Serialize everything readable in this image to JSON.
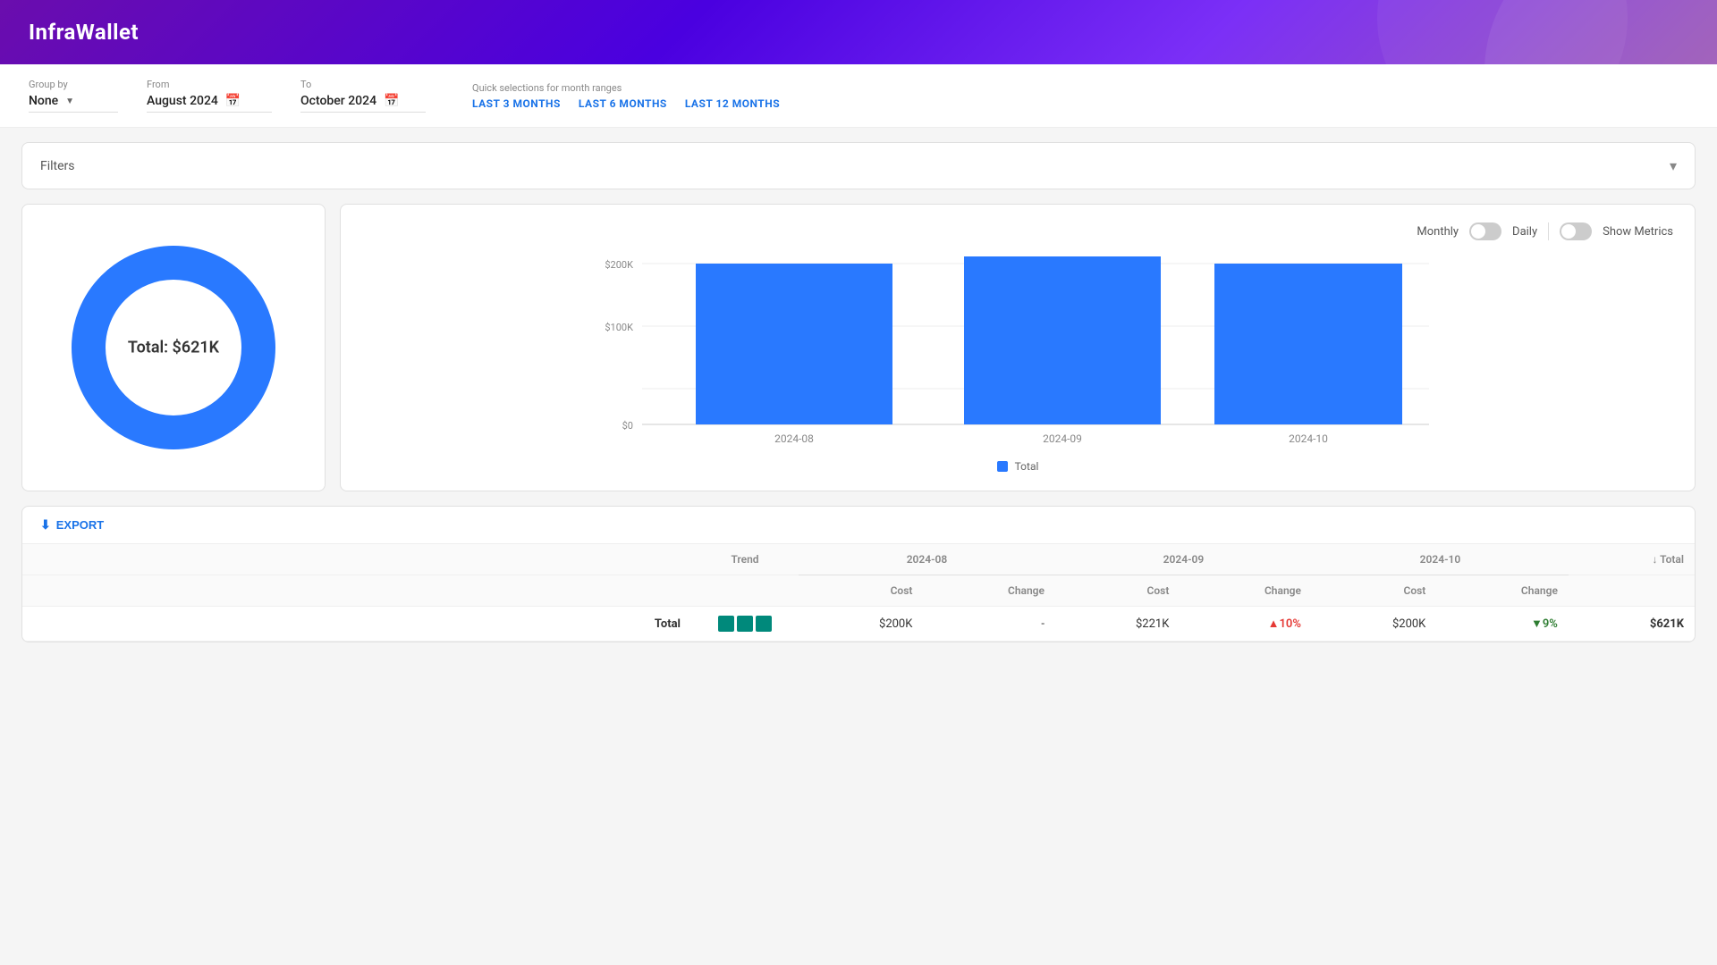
{
  "header": {
    "logo": "InfraWallet"
  },
  "controls": {
    "group_by_label": "Group by",
    "group_by_value": "None",
    "from_label": "From",
    "from_value": "August 2024",
    "to_label": "To",
    "to_value": "October 2024",
    "quick_label": "Quick selections for month ranges",
    "quick_links": [
      {
        "id": "last3",
        "label": "LAST 3 MONTHS"
      },
      {
        "id": "last6",
        "label": "LAST 6 MONTHS"
      },
      {
        "id": "last12",
        "label": "LAST 12 MONTHS"
      }
    ]
  },
  "filters": {
    "label": "Filters"
  },
  "chart_controls": {
    "monthly_label": "Monthly",
    "daily_label": "Daily",
    "show_metrics_label": "Show Metrics"
  },
  "donut_chart": {
    "total_label": "Total: $621K"
  },
  "bar_chart": {
    "bars": [
      {
        "month": "2024-08",
        "value": 200,
        "label": "$200K"
      },
      {
        "month": "2024-09",
        "value": 221,
        "label": "$221K"
      },
      {
        "month": "2024-10",
        "value": 200,
        "label": "$200K"
      }
    ],
    "y_labels": [
      "$0",
      "$100K",
      "$200K"
    ],
    "legend": "Total",
    "bar_color": "#2979ff"
  },
  "table": {
    "export_label": "EXPORT",
    "col_trend": "Trend",
    "columns": [
      {
        "id": "2024-08",
        "label": "2024-08"
      },
      {
        "id": "2024-09",
        "label": "2024-09"
      },
      {
        "id": "2024-10",
        "label": "2024-10"
      }
    ],
    "sub_cols": [
      "Cost",
      "Change"
    ],
    "total_col": "Total",
    "rows": [
      {
        "name": "Total",
        "trend": [
          "#00897b",
          "#00897b",
          "#00897b"
        ],
        "data": [
          {
            "cost": "$200K",
            "change": "-"
          },
          {
            "cost": "$221K",
            "change": "▲10%",
            "change_type": "up"
          },
          {
            "cost": "$200K",
            "change": "▼9%",
            "change_type": "down"
          }
        ],
        "total": "$621K"
      }
    ]
  }
}
